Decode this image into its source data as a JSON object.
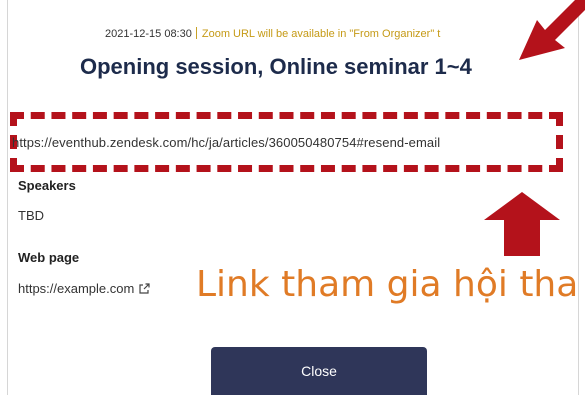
{
  "event": {
    "datetime": "2021-12-15 08:30",
    "zoom_notice": "Zoom URL will be available in \"From Organizer\" t",
    "title": "Opening session, Online seminar 1~4"
  },
  "highlight": {
    "url": "https://eventhub.zendesk.com/hc/ja/articles/360050480754#resend-email",
    "color": "#b4121b"
  },
  "speakers": {
    "label": "Speakers",
    "value": "TBD"
  },
  "web_page": {
    "label": "Web page",
    "value": "https://example.com"
  },
  "overlay": {
    "text": "Link tham gia hội tha",
    "color": "#e07b26"
  },
  "footer": {
    "close_label": "Close"
  },
  "colors": {
    "title": "#1d2b4b",
    "button_bg": "#2f3659",
    "notice": "#c59a16"
  }
}
